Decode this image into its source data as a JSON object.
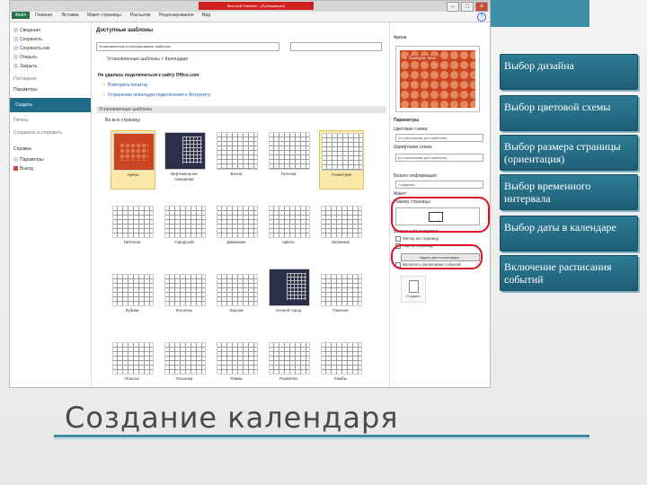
{
  "window": {
    "title": "Microsoft Publisher - [Публикация1]",
    "tabs": [
      "Файл",
      "Главная",
      "Вставка",
      "Макет страницы",
      "Рассылки",
      "Рецензирование",
      "Вид"
    ]
  },
  "leftnav": {
    "items": [
      "Сведения",
      "Сохранить",
      "Сохранить как",
      "Открыть",
      "Закрыть"
    ],
    "recent": "Последние",
    "selected": "Создать",
    "print": "Печать",
    "share_head": "Сохранить и отправить",
    "help_head": "Справка",
    "params": "Параметры",
    "exit": "Выход"
  },
  "center": {
    "heading": "Доступные шаблоны",
    "dropdown": "Установленные и интерактивные шаблоны",
    "nav_path": "Установленные шаблоны > Календари",
    "error": "Не удалось подключиться к сайту Office.com",
    "links": [
      "Повторить попытку",
      "Устранение неполадок подключения к Интернету"
    ],
    "section": "Установленные шаблоны",
    "subsection": "Во всю страницу",
    "templates": [
      {
        "label": "Арена",
        "style": "red",
        "selected": true
      },
      {
        "label": "Вертикальное смещение",
        "style": "dark",
        "selected": false
      },
      {
        "label": "Волна",
        "style": "grid",
        "selected": false
      },
      {
        "label": "Галочки",
        "style": "grid",
        "selected": false
      },
      {
        "label": "Геометрия",
        "style": "grid",
        "selected": true
      },
      {
        "label": "Гипотеза",
        "style": "grid",
        "selected": false
      },
      {
        "label": "Городской",
        "style": "grid",
        "selected": false
      },
      {
        "label": "Движение",
        "style": "grid",
        "selected": false
      },
      {
        "label": "Цветы",
        "style": "grid",
        "selected": false
      },
      {
        "label": "Затмение",
        "style": "grid",
        "selected": false
      },
      {
        "label": "Кубики",
        "style": "grid",
        "selected": false
      },
      {
        "label": "Колонны",
        "style": "grid",
        "selected": false
      },
      {
        "label": "Корона",
        "style": "grid",
        "selected": false
      },
      {
        "label": "Ночной город",
        "style": "dark",
        "selected": false
      },
      {
        "label": "Пиксели",
        "style": "grid",
        "selected": false
      },
      {
        "label": "Полосы",
        "style": "grid",
        "selected": false
      },
      {
        "label": "Посылки",
        "style": "grid",
        "selected": false
      },
      {
        "label": "Рамки",
        "style": "grid",
        "selected": false
      },
      {
        "label": "Разметка",
        "style": "grid",
        "selected": false
      },
      {
        "label": "Ромбы",
        "style": "grid",
        "selected": false
      }
    ]
  },
  "rightpanel": {
    "heading": "Арена",
    "preview_text": "Sample text",
    "params": "Параметры",
    "color_scheme": "Цветовая схема",
    "color_value": "(по умолчанию для шаблона)",
    "font_scheme": "Шрифтовая схема",
    "font_value": "(по умолчанию для шаблона)",
    "business_info": "Бизнес-информация",
    "business_value": "Создание...",
    "layout_head": "Макет",
    "page_size": "Размер страницы",
    "timeframe": "Временной интервал",
    "one_month": "Месяц на страницу",
    "one_year": "Год на страницу",
    "set_dates": "Задать даты календаря...",
    "schedule": "Включить расписание событий",
    "create": "Создать"
  },
  "slide": {
    "title": "Создание календаря",
    "features": [
      "Выбор дизайна",
      "Выбор цветовой схемы",
      "Выбор размера страницы (ориентация)",
      "Выбор временного интервала",
      "Выбор даты в календаре",
      "Включение расписания событий"
    ]
  },
  "colors": {
    "accent": "#3e8fa5",
    "feature_box": "#1e5f77",
    "highlight": "#e0102a"
  }
}
